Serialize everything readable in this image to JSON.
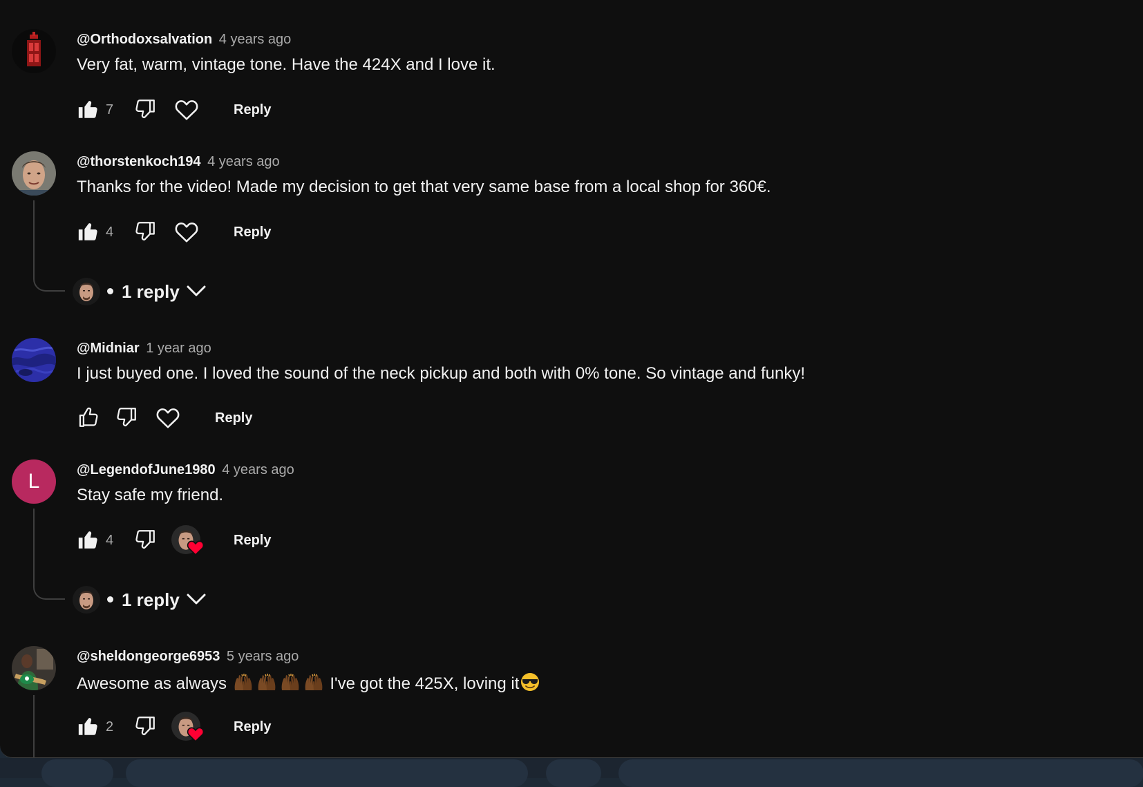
{
  "comments": [
    {
      "author": "@Orthodoxsalvation",
      "time": "4 years ago",
      "text": "Very fat, warm, vintage tone. Have the 424X and I love it.",
      "likes": "7",
      "liked": true,
      "reply_label": "Reply"
    },
    {
      "author": "@thorstenkoch194",
      "time": "4 years ago",
      "text": "Thanks for the video! Made my decision to get that very same base from a local shop for 360€.",
      "likes": "4",
      "liked": true,
      "reply_label": "Reply",
      "replies_label": "1 reply"
    },
    {
      "author": "@Midniar",
      "time": "1 year ago",
      "text": "I just buyed one. I loved the sound of the neck pickup and both with 0% tone. So vintage and funky!",
      "likes": "",
      "liked": false,
      "reply_label": "Reply"
    },
    {
      "author": "@LegendofJune1980",
      "avatar_letter": "L",
      "time": "4 years ago",
      "text": "Stay safe my friend.",
      "likes": "4",
      "liked": true,
      "creator_hearted": true,
      "reply_label": "Reply",
      "replies_label": "1 reply"
    },
    {
      "author": "@sheldongeorge6953",
      "time": "5 years ago",
      "text_before": "Awesome as always",
      "emoji_sequence": [
        "raising-hands",
        "raising-hands",
        "raising-hands",
        "raising-hands"
      ],
      "text_after": "I've got the 425X, loving it",
      "trailing_emoji": "smiling-face-with-sunglasses",
      "likes": "2",
      "liked": true,
      "creator_hearted": true,
      "reply_label": "Reply"
    }
  ],
  "colors": {
    "background": "#0f0f0f",
    "text_primary": "#f1f1f1",
    "text_secondary": "#aaaaaa",
    "letter_avatar": "#b8295f",
    "heart_badge": "#ff0033"
  }
}
